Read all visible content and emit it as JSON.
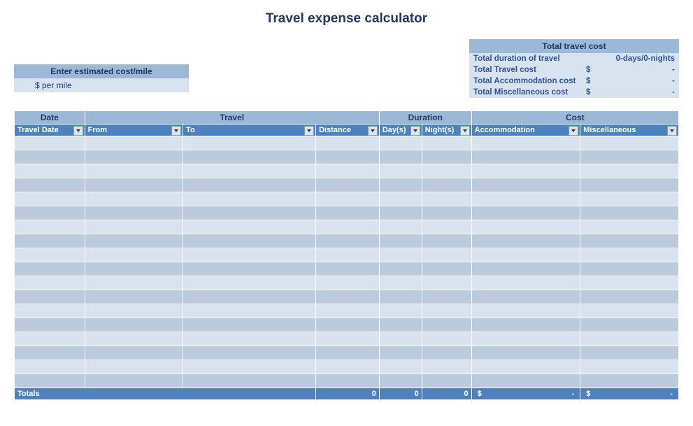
{
  "title": "Travel expense calculator",
  "estimate": {
    "header": "Enter estimated cost/mile",
    "label": "$ per mile"
  },
  "summary": {
    "header": "Total travel cost",
    "rows": [
      {
        "label": "Total duration of travel",
        "cur": "",
        "value": "0-days/0-nights"
      },
      {
        "label": "Total Travel cost",
        "cur": "$",
        "value": "-"
      },
      {
        "label": "Total Accommodation cost",
        "cur": "$",
        "value": "-"
      },
      {
        "label": "Total Miscellaneous cost",
        "cur": "$",
        "value": "-"
      }
    ]
  },
  "groups": {
    "date": "Date",
    "travel": "Travel",
    "duration": "Duration",
    "cost": "Cost"
  },
  "columns": {
    "travel_date": "Travel Date",
    "from": "From",
    "to": "To",
    "distance": "Distance",
    "days": "Day(s)",
    "nights": "Night(s)",
    "accommodation": "Accommodation",
    "misc": "Miscellaneous"
  },
  "row_count": 18,
  "totals": {
    "label": "Totals",
    "distance": "0",
    "days": "0",
    "nights": "0",
    "accom_cur": "$",
    "accom_val": "-",
    "misc_cur": "$",
    "misc_val": "-"
  }
}
